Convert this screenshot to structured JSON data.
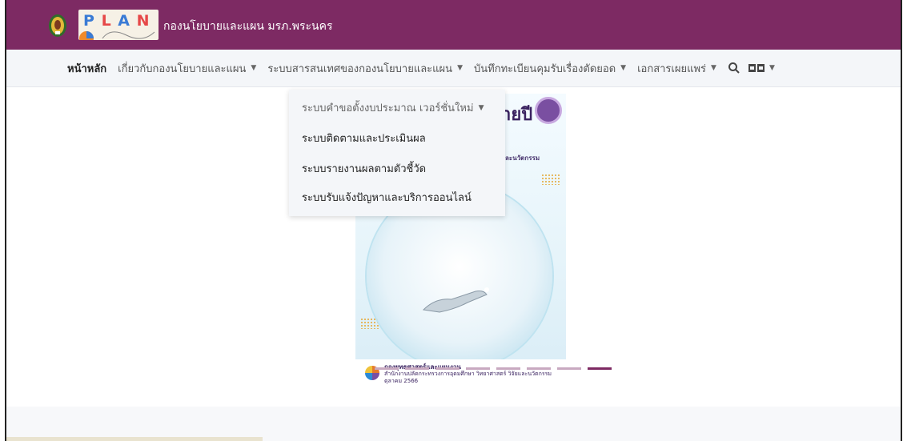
{
  "header": {
    "logo_text": [
      "P",
      "L",
      "A",
      "N"
    ],
    "site_title": "กองนโยบายและแผน มรภ.พระนคร",
    "bar_color": "#7d2a63"
  },
  "nav": {
    "items": [
      {
        "label": "หน้าหลัก",
        "has_caret": false,
        "active": true
      },
      {
        "label": "เกี่ยวกับกองนโยบายและแผน",
        "has_caret": true
      },
      {
        "label": "ระบบสารสนเทศของกองนโยบายและแผน",
        "has_caret": true
      },
      {
        "label": "บันทึกทะเบียนคุมรับเรื่องตัดยอด",
        "has_caret": true
      },
      {
        "label": "เอกสารเผยแพร่",
        "has_caret": true
      }
    ],
    "search_icon": "search-icon",
    "language_icon": "language-flag-icon"
  },
  "dropdown": {
    "items": [
      {
        "label": "ระบบคำขอตั้งงบประมาณ เวอร์ชั่นใหม่",
        "has_caret": true
      },
      {
        "label": "ระบบติดตามและประเมินผล"
      },
      {
        "label": "ระบบรายงานผลตามตัวชี้วัด"
      },
      {
        "label": "ระบบรับแจ้งปัญหาและบริการออนไลน์"
      }
    ]
  },
  "slider": {
    "poster_title": "ายปี",
    "poster_subtitle": "วิจัยและนวัตกรรม",
    "footer_title": "กองยุทธศาสตร์และแผนงาน",
    "footer_line": "สำนักงานปลัดกระทรวงการอุดมศึกษา วิทยาศาสตร์ วิจัยและนวัตกรรม",
    "footer_date": "ตุลาคม 2566",
    "active_slide": 8,
    "slide_count": 8
  }
}
